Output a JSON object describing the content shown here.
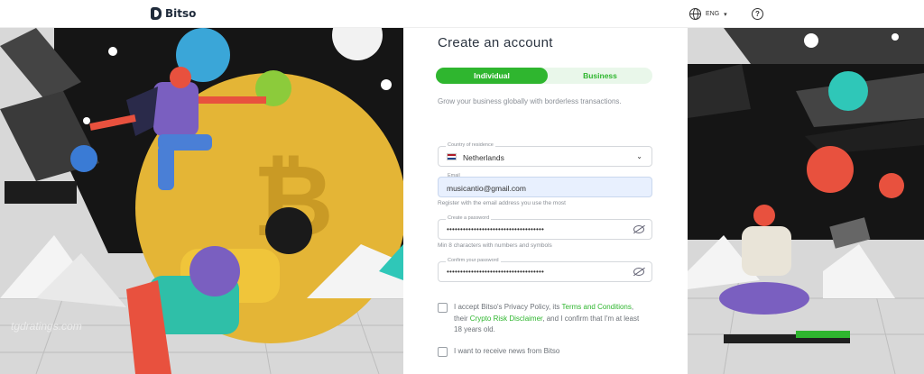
{
  "header": {
    "brand": "Bitso",
    "language": "ENG",
    "help": "?"
  },
  "form": {
    "title": "Create an account",
    "tabs": [
      {
        "label": "Individual",
        "active": true
      },
      {
        "label": "Business",
        "active": false
      }
    ],
    "description": "Grow your business globally with borderless transactions.",
    "country": {
      "label": "Country of residence",
      "value": "Netherlands"
    },
    "email": {
      "label": "Email",
      "value": "musicantio@gmail.com",
      "hint": "Register with the email address you use the most"
    },
    "password": {
      "label": "Create a password",
      "value": "••••••••••••••••••••••••••••••••••••",
      "hint": "Min 8 characters with numbers and symbols"
    },
    "confirm": {
      "label": "Confirm your password",
      "value": "••••••••••••••••••••••••••••••••••••"
    },
    "terms": {
      "prefix": "I accept Bitso's Privacy Policy, its ",
      "link1": "Terms and Conditions",
      "middle": ", their ",
      "link2": "Crypto Risk Disclaimer",
      "suffix": ", and I confirm that I'm at least 18 years old."
    },
    "news": "I want to receive news from Bitso"
  },
  "watermark": "tgdratings.com",
  "colors": {
    "accent": "#2fb62f",
    "toggle_bg": "#e9f7ea",
    "field_filled": "#e8f0fe"
  }
}
